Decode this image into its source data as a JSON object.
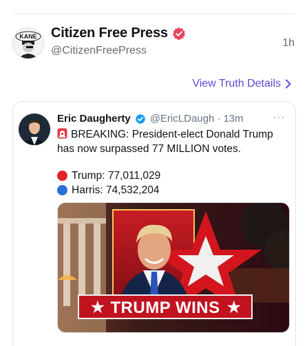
{
  "truth": {
    "author": {
      "name": "Citizen Free Press",
      "handle": "@CitizenFreePress",
      "avatar_text": "KANE",
      "verified_badge": "verified-badge-icon",
      "badge_color": "#e8445a"
    },
    "time": "1h",
    "view_details_label": "View Truth Details",
    "view_details_color": "#5b4ad6"
  },
  "quoted": {
    "author": {
      "name": "Eric Daugherty",
      "handle": "@EricLDaugh",
      "separator": "·",
      "time": "13m",
      "verified_badge": "blue-check-icon",
      "badge_color": "#1d9bf0"
    },
    "more_label": "···",
    "body": "BREAKING: President-elect Donald Trump has now surpassed 77 MILLION votes.",
    "results": [
      {
        "label": "Trump: 77,011,029",
        "color": "#e0222b"
      },
      {
        "label": "Harris: 74,532,204",
        "color": "#2a6fd6"
      }
    ],
    "image": {
      "banner_text": "TRUMP WINS",
      "star_glyph": "★"
    }
  }
}
